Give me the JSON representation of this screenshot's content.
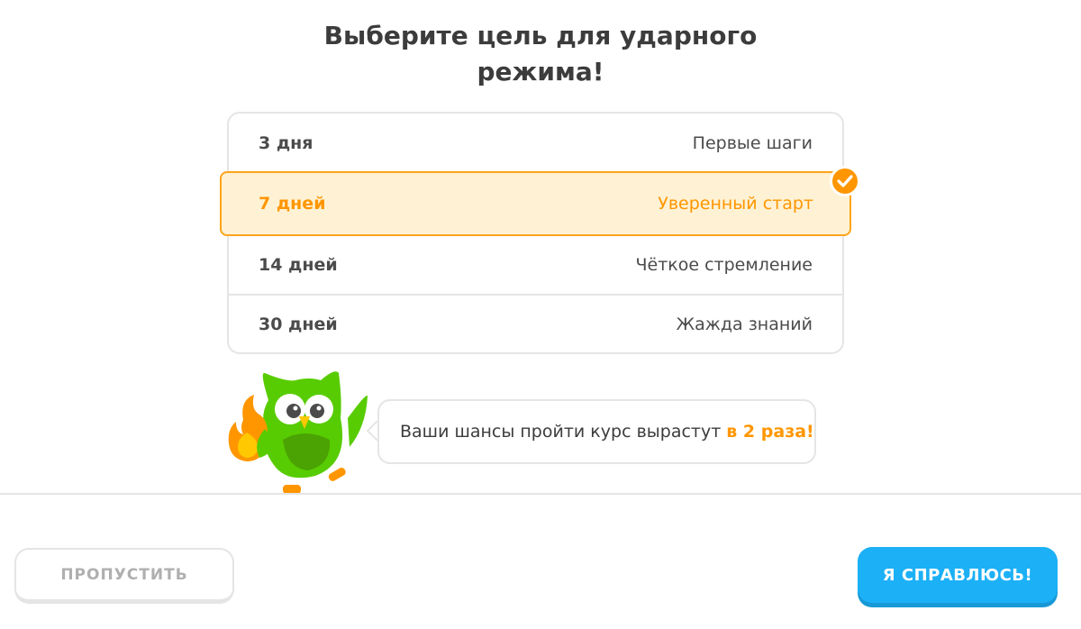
{
  "title": "Выберите цель для ударного режима!",
  "goals": [
    {
      "days": "3 дня",
      "label": "Первые шаги"
    },
    {
      "days": "7 дней",
      "label": "Уверенный старт"
    },
    {
      "days": "14 дней",
      "label": "Чёткое стремление"
    },
    {
      "days": "30 дней",
      "label": "Жажда знаний"
    }
  ],
  "selected_goal_index": 1,
  "mascot": {
    "icon": "owl-mascot-icon",
    "holding": "flame-icon"
  },
  "bubble": {
    "text": "Ваши шансы пройти курс вырастут",
    "highlight": "в 2 раза!"
  },
  "buttons": {
    "skip": "ПРОПУСТИТЬ",
    "confirm": "Я СПРАВЛЮСЬ!"
  },
  "colors": {
    "accent_orange": "#ff9600",
    "selected_bg": "#fff2d4",
    "primary_blue": "#1cb0f6",
    "owl_green": "#58cc02"
  }
}
